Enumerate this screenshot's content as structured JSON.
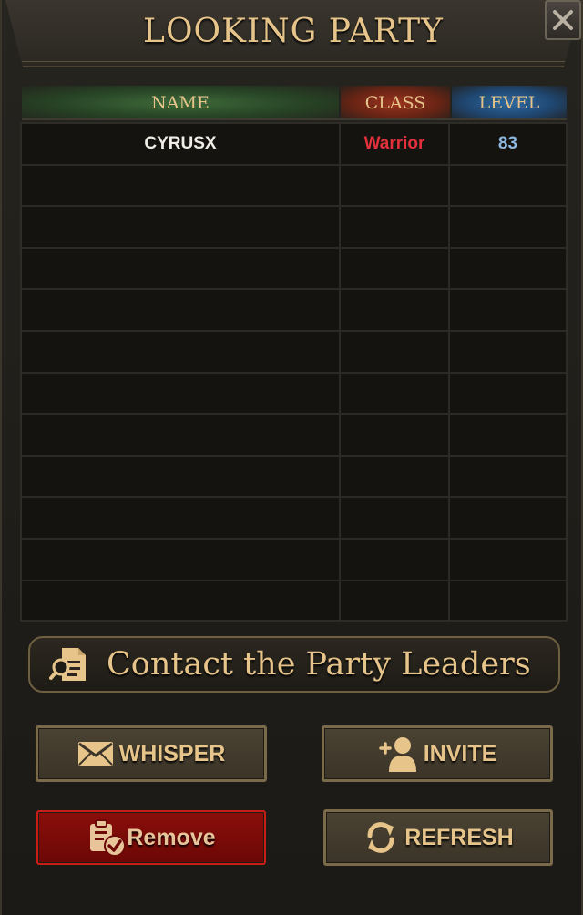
{
  "window": {
    "title": "LOOKING PARTY"
  },
  "table": {
    "columns": {
      "name": "NAME",
      "class": "CLASS",
      "level": "LEVEL"
    },
    "rows": [
      {
        "name": "CYRUSX",
        "class": "Warrior",
        "level": "83"
      },
      {
        "name": "",
        "class": "",
        "level": ""
      },
      {
        "name": "",
        "class": "",
        "level": ""
      },
      {
        "name": "",
        "class": "",
        "level": ""
      },
      {
        "name": "",
        "class": "",
        "level": ""
      },
      {
        "name": "",
        "class": "",
        "level": ""
      },
      {
        "name": "",
        "class": "",
        "level": ""
      },
      {
        "name": "",
        "class": "",
        "level": ""
      },
      {
        "name": "",
        "class": "",
        "level": ""
      },
      {
        "name": "",
        "class": "",
        "level": ""
      },
      {
        "name": "",
        "class": "",
        "level": ""
      },
      {
        "name": "",
        "class": "",
        "level": ""
      }
    ]
  },
  "actions": {
    "contact_label": "Contact the Party Leaders",
    "whisper_label": "WHISPER",
    "invite_label": "INVITE",
    "remove_label": "Remove",
    "refresh_label": "REFRESH"
  },
  "icons": {
    "close": "close-icon",
    "contact": "document-search-icon",
    "whisper": "envelope-icon",
    "invite": "add-user-icon",
    "remove": "clipboard-check-icon",
    "refresh": "refresh-icon"
  },
  "colors": {
    "title_gold": "#e6c48a",
    "class_red": "#e2313a",
    "level_blue": "#8fb8e0",
    "name_header_green": "#3f6a3a",
    "class_header_red": "#9a3420",
    "level_header_blue": "#2f6aa2",
    "remove_button_red": "#8a0e0a"
  }
}
